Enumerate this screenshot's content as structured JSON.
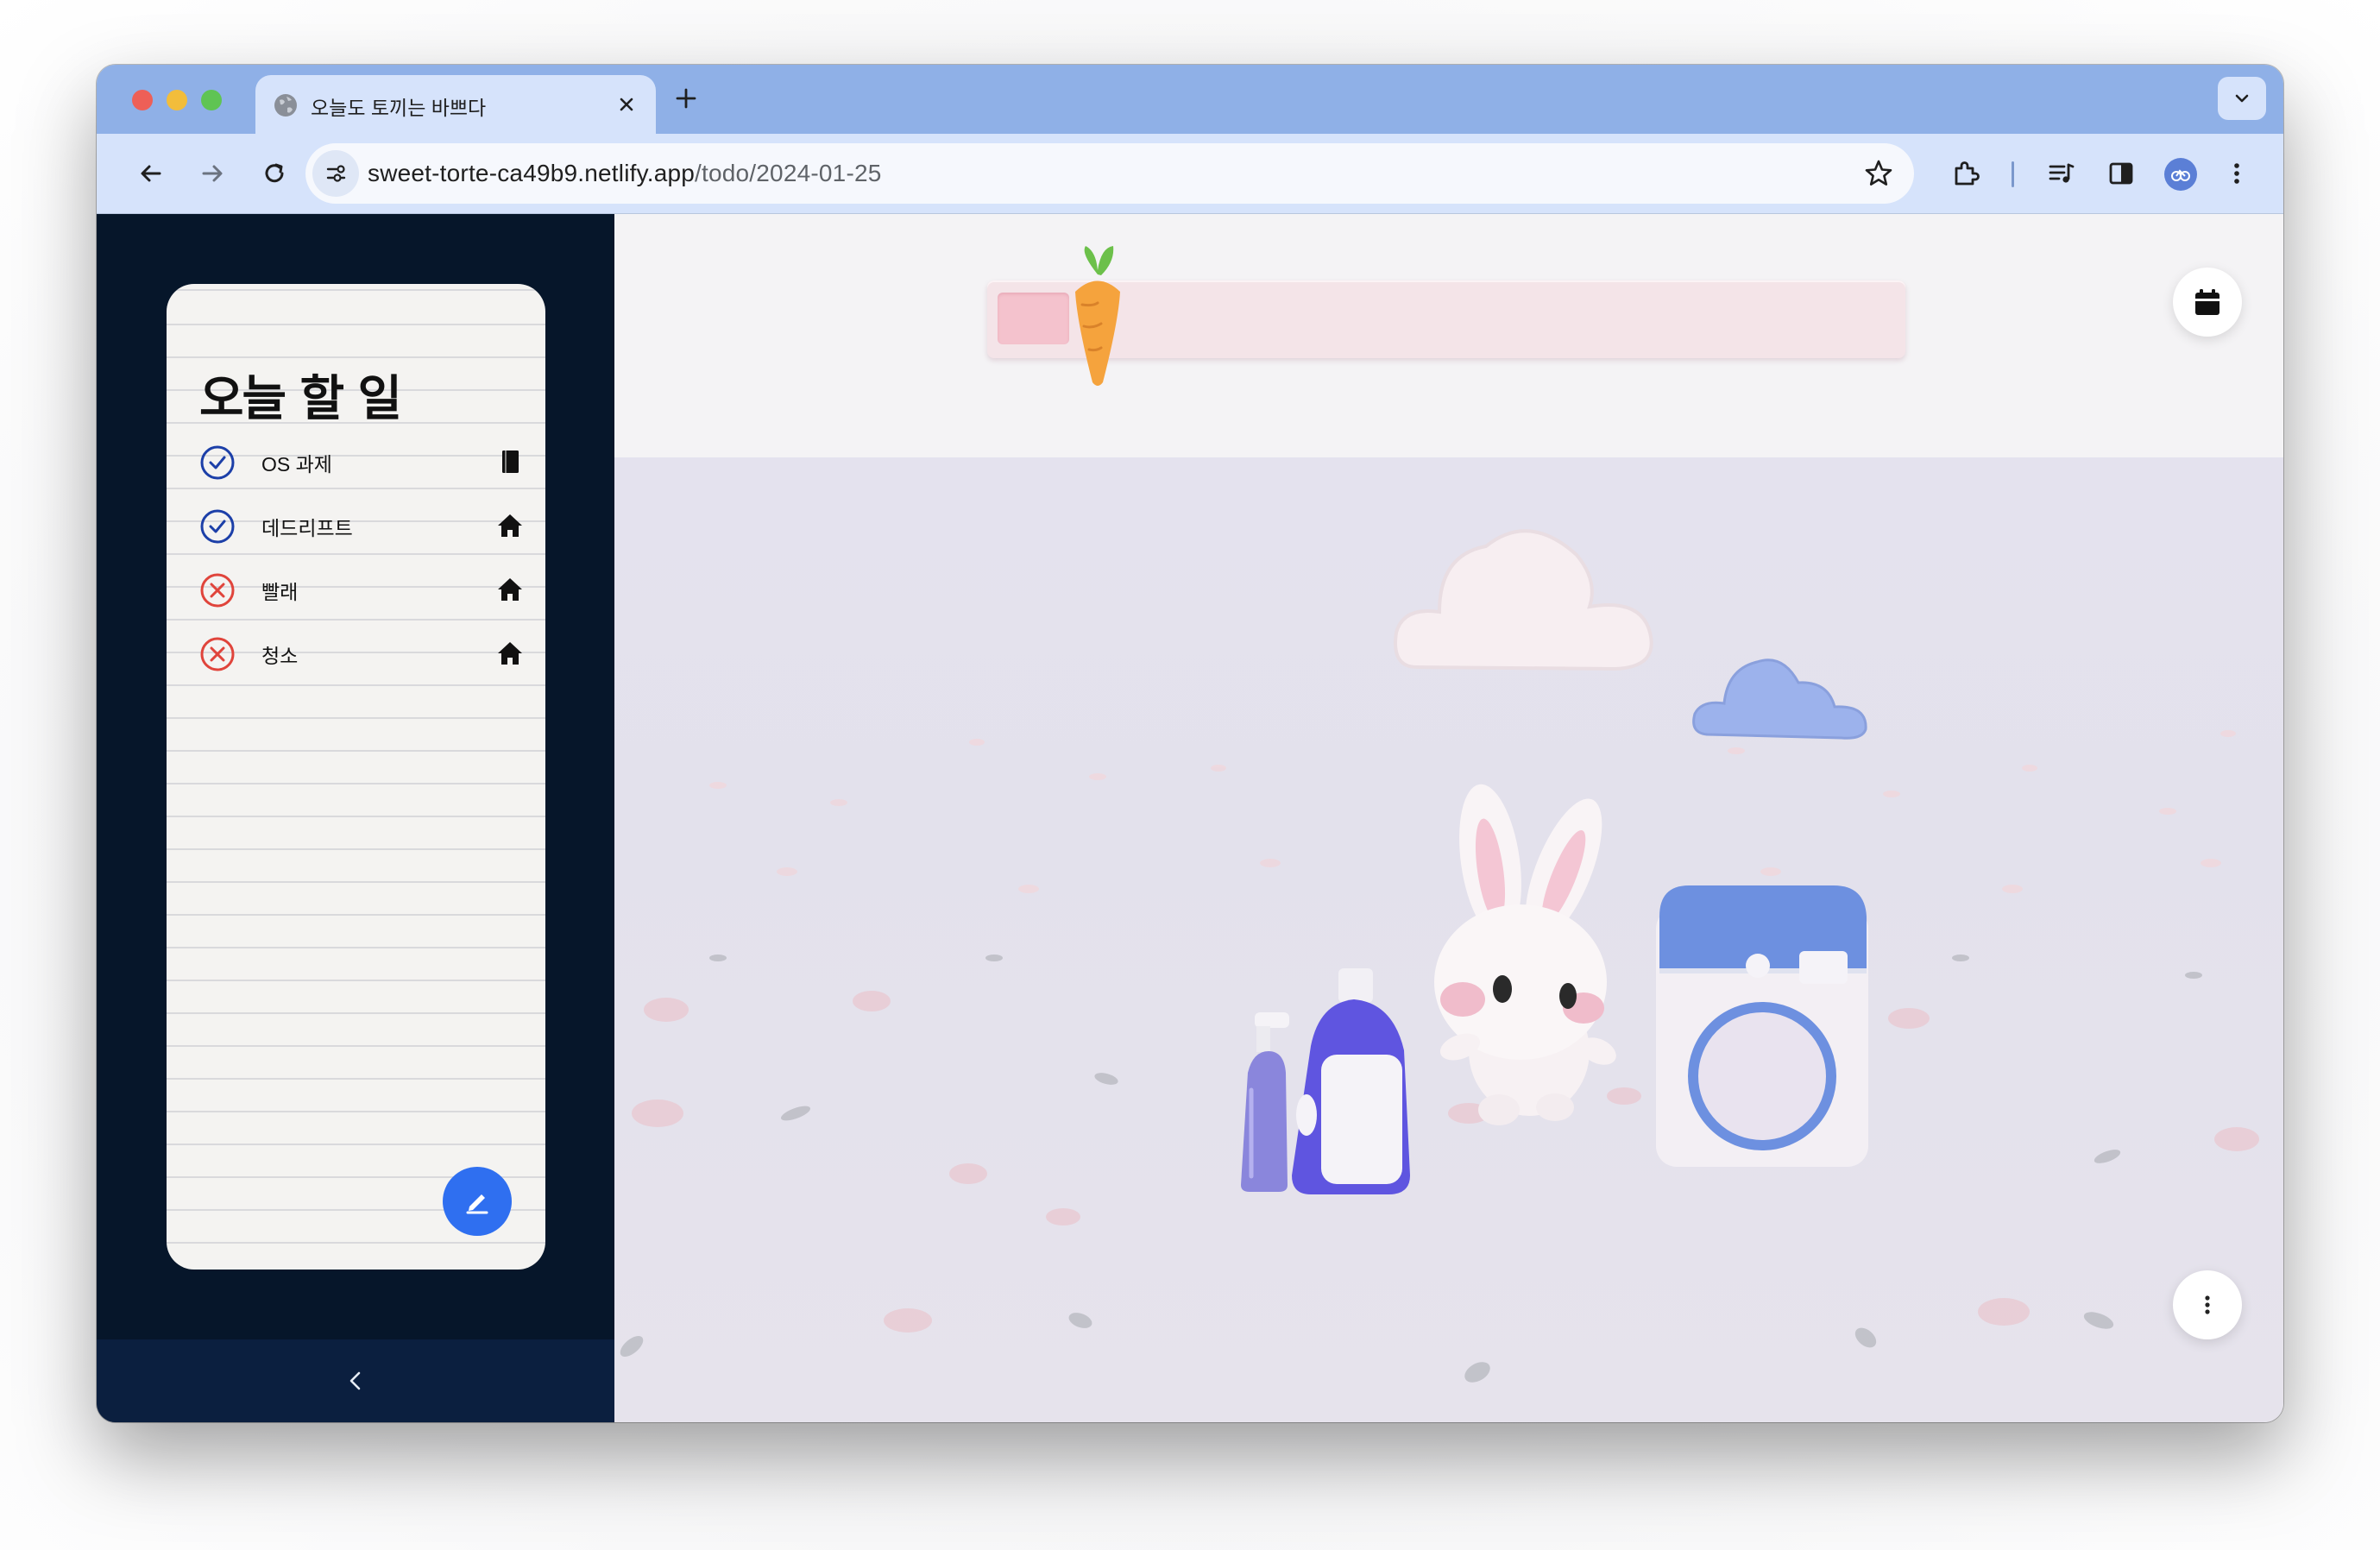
{
  "browser": {
    "tab_title": "오늘도 토끼는 바쁘다",
    "url_host": "sweet-torte-ca49b9.netlify.app",
    "url_path": "/todo/2024-01-25"
  },
  "sidebar": {
    "title": "오늘 할 일",
    "todos": [
      {
        "label": "OS 과제",
        "status": "done",
        "category_icon": "book-icon"
      },
      {
        "label": "데드리프트",
        "status": "done",
        "category_icon": "home-icon"
      },
      {
        "label": "빨래",
        "status": "not-done",
        "category_icon": "home-icon"
      },
      {
        "label": "청소",
        "status": "not-done",
        "category_icon": "home-icon"
      }
    ],
    "edit_icon": "pencil-icon",
    "collapse_icon": "chevron-left-icon"
  },
  "scene": {
    "progress_fraction": 0.08,
    "progress_icon": "carrot-icon",
    "calendar_icon": "calendar-icon",
    "more_icon": "more-vertical-icon"
  },
  "colors": {
    "tab_strip": "#8fb0e7",
    "toolbar": "#d6e3fb",
    "sidebar": "#06162a",
    "done_check": "#1c3fa8",
    "not_done_x": "#e0443b",
    "fab": "#2f6ff0",
    "progress_fill": "#f4c2cd"
  }
}
